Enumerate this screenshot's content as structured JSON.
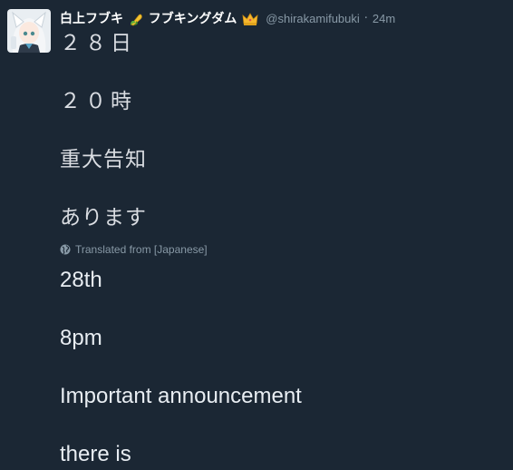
{
  "tweet": {
    "display_name_part1": "白上フブキ",
    "display_name_part2": "フブキングダム",
    "handle": "@shirakamifubuki",
    "separator": "·",
    "timestamp": "24m",
    "original_lines": [
      "２８日",
      "２０時",
      "重大告知",
      "あります"
    ],
    "translated_from": "Translated from [Japanese]",
    "translated_lines": [
      "28th",
      "8pm",
      "Important announcement",
      "there is"
    ]
  },
  "colors": {
    "background": "#1b2734",
    "name": "#ffffff",
    "muted": "#8899a6",
    "text": "#dadde2"
  },
  "icons": {
    "avatar": "avatar-image",
    "corn_emoji": "corn-emoji-icon",
    "crown_emoji": "crown-emoji-icon",
    "globe": "globe-icon"
  }
}
